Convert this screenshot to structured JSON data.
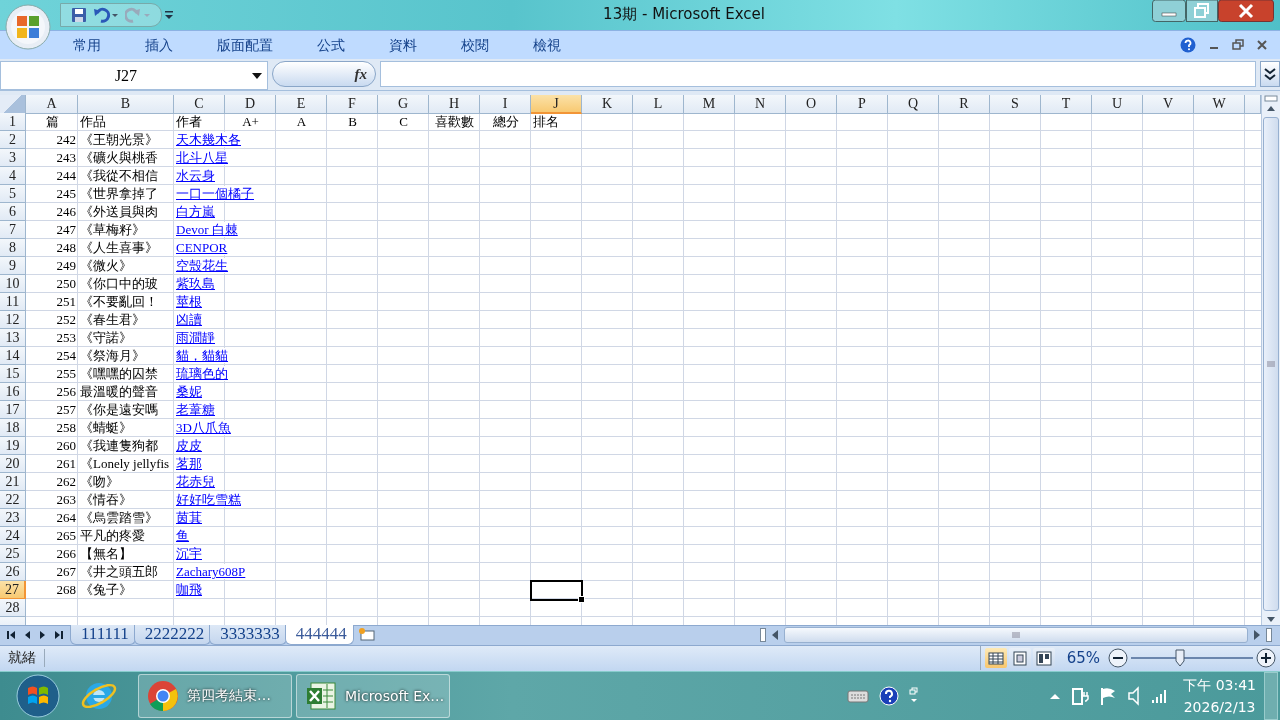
{
  "window": {
    "title": "13期 - Microsoft Excel"
  },
  "ribbon_tabs": [
    "常用",
    "插入",
    "版面配置",
    "公式",
    "資料",
    "校閱",
    "檢視"
  ],
  "formula_bar": {
    "name_box": "J27",
    "function_label": "fx"
  },
  "columns": [
    {
      "label": "A",
      "selected": false
    },
    {
      "label": "B",
      "selected": false
    },
    {
      "label": "C",
      "selected": false
    },
    {
      "label": "D",
      "selected": false
    },
    {
      "label": "E",
      "selected": false
    },
    {
      "label": "F",
      "selected": false
    },
    {
      "label": "G",
      "selected": false
    },
    {
      "label": "H",
      "selected": false
    },
    {
      "label": "I",
      "selected": false
    },
    {
      "label": "J",
      "selected": true
    },
    {
      "label": "K",
      "selected": false
    },
    {
      "label": "L",
      "selected": false
    },
    {
      "label": "M",
      "selected": false
    },
    {
      "label": "N",
      "selected": false
    },
    {
      "label": "O",
      "selected": false
    },
    {
      "label": "P",
      "selected": false
    },
    {
      "label": "Q",
      "selected": false
    },
    {
      "label": "R",
      "selected": false
    },
    {
      "label": "S",
      "selected": false
    },
    {
      "label": "T",
      "selected": false
    },
    {
      "label": "U",
      "selected": false
    },
    {
      "label": "V",
      "selected": false
    },
    {
      "label": "W",
      "selected": false
    }
  ],
  "header_row": {
    "number": "1",
    "cells": [
      "篇",
      "作品",
      "作者",
      "A+",
      "A",
      "B",
      "C",
      "喜歡數",
      "總分",
      "排名"
    ]
  },
  "rows": [
    {
      "number": "2",
      "selected": false,
      "index": "242",
      "title": "《王朝光景》",
      "author": "天木幾木各"
    },
    {
      "number": "3",
      "selected": false,
      "index": "243",
      "title": "《礦火與桃香",
      "author": "北斗八星"
    },
    {
      "number": "4",
      "selected": false,
      "index": "244",
      "title": "《我從不相信",
      "author": "水云身"
    },
    {
      "number": "5",
      "selected": false,
      "index": "245",
      "title": "《世界拿掉了",
      "author": "一口一個橘子"
    },
    {
      "number": "6",
      "selected": false,
      "index": "246",
      "title": "《外送員與肉",
      "author": "白方嵐"
    },
    {
      "number": "7",
      "selected": false,
      "index": "247",
      "title": "《草梅籽》",
      "author": "Devor 白棘"
    },
    {
      "number": "8",
      "selected": false,
      "index": "248",
      "title": "《人生喜事》",
      "author": "CENPOR"
    },
    {
      "number": "9",
      "selected": false,
      "index": "249",
      "title": "《微火》",
      "author": "空殼花生"
    },
    {
      "number": "10",
      "selected": false,
      "index": "250",
      "title": "《你口中的玻",
      "author": "紫玖島"
    },
    {
      "number": "11",
      "selected": false,
      "index": "251",
      "title": "《不要亂回！",
      "author": "莖根"
    },
    {
      "number": "12",
      "selected": false,
      "index": "252",
      "title": "《春生君》",
      "author": "凶讀"
    },
    {
      "number": "13",
      "selected": false,
      "index": "253",
      "title": "《守諾》",
      "author": "雨澗靜"
    },
    {
      "number": "14",
      "selected": false,
      "index": "254",
      "title": "《祭海月》",
      "author": "貓，貓貓"
    },
    {
      "number": "15",
      "selected": false,
      "index": "255",
      "title": "《嘿嘿的囚禁",
      "author": "琉璃色的"
    },
    {
      "number": "16",
      "selected": false,
      "index": "256",
      "title": "最溫暖的聲音",
      "author": "桑妮"
    },
    {
      "number": "17",
      "selected": false,
      "index": "257",
      "title": "《你是遠安嗎",
      "author": "老葦糖"
    },
    {
      "number": "18",
      "selected": false,
      "index": "258",
      "title": "《蜻蜓》",
      "author": "3D八爪魚"
    },
    {
      "number": "19",
      "selected": false,
      "index": "260",
      "title": "《我連隻狗都",
      "author": "皮皮"
    },
    {
      "number": "20",
      "selected": false,
      "index": "261",
      "title": "《Lonely jellyfis",
      "author": "茗那"
    },
    {
      "number": "21",
      "selected": false,
      "index": "262",
      "title": "《吻》",
      "author": "花赤兒"
    },
    {
      "number": "22",
      "selected": false,
      "index": "263",
      "title": "《情吞》",
      "author": "好好吃雪糕"
    },
    {
      "number": "23",
      "selected": false,
      "index": "264",
      "title": "《烏雲踏雪》",
      "author": "茵萁"
    },
    {
      "number": "24",
      "selected": false,
      "index": "265",
      "title": "平凡的疼愛",
      "author": "鱼"
    },
    {
      "number": "25",
      "selected": false,
      "index": "266",
      "title": "【無名】",
      "author": "沉宇"
    },
    {
      "number": "26",
      "selected": false,
      "index": "267",
      "title": "《井之頭五郎",
      "author": "Zachary608P"
    },
    {
      "number": "27",
      "selected": true,
      "index": "268",
      "title": "《兔子》",
      "author": "咖飛"
    },
    {
      "number": "28",
      "selected": false
    }
  ],
  "sheet_tabs": [
    {
      "label": "111111",
      "selected": false
    },
    {
      "label": "2222222",
      "selected": false
    },
    {
      "label": "3333333",
      "selected": false
    },
    {
      "label": "444444",
      "selected": true
    }
  ],
  "status_bar": {
    "status": "就緒",
    "view_buttons": [
      {
        "kind": "normal",
        "selected": true
      },
      {
        "kind": "page_layout",
        "selected": false
      },
      {
        "kind": "page_break",
        "selected": false
      }
    ],
    "zoom": "65%",
    "zoom_slider": {
      "level": 0.4
    }
  },
  "taskbar": {
    "tasks": [
      {
        "kind": "chrome",
        "label": "第四考結束…"
      },
      {
        "kind": "excel",
        "label": "Microsoft Ex…"
      }
    ],
    "time": "下午 03:41",
    "date": "2026/2/13"
  }
}
